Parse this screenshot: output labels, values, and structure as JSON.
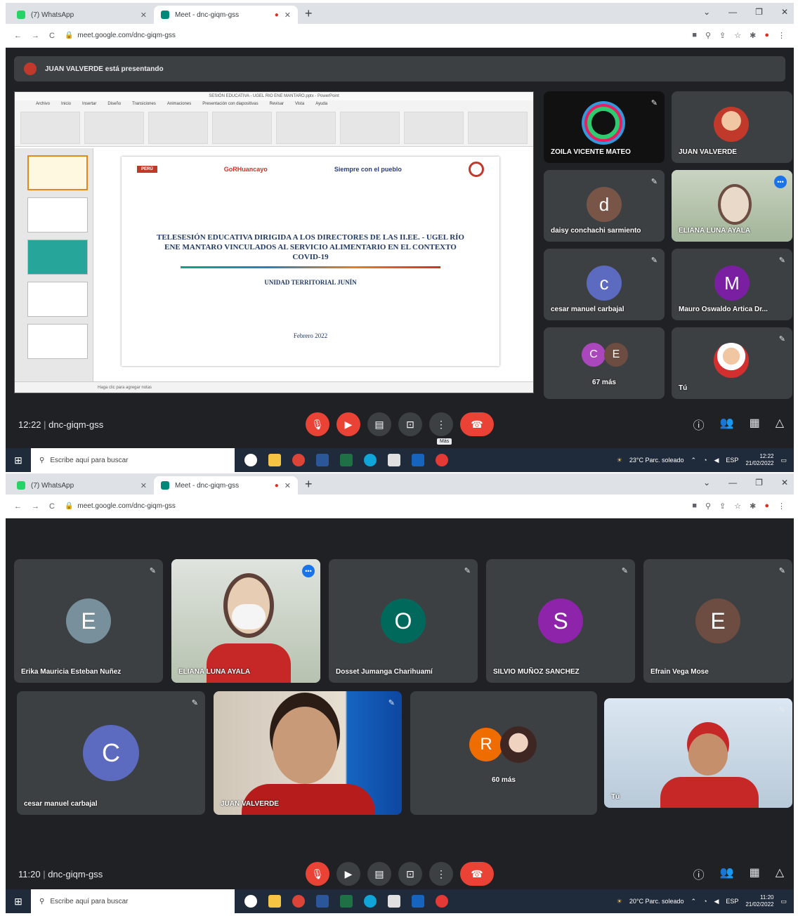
{
  "s1": {
    "tabs": [
      {
        "label": "(7) WhatsApp",
        "color": "#25d366",
        "active": false
      },
      {
        "label": "Meet - dnc-giqm-gss",
        "color": "#00897b",
        "active": true
      }
    ],
    "url": "meet.google.com/dnc-giqm-gss",
    "presenting": "JUAN VALVERDE está presentando",
    "slide": {
      "window_title": "SESIÓN EDUCATIVA - UGEL RIO ENE MANTARO.pptx - PowerPoint",
      "ribbon_tabs": [
        "Archivo",
        "Inicio",
        "Insertar",
        "Diseño",
        "Transiciones",
        "Animaciones",
        "Presentación con diapositivas",
        "Revisar",
        "Vista",
        "Ayuda"
      ],
      "logo_peru": "PERÚ",
      "logo_gore": "GoRHuancayo",
      "logo_siempre": "Siempre con el pueblo",
      "title": "TELESESIÓN EDUCATIVA DIRIGIDA A LOS DIRECTORES DE LAS II.EE. - UGEL RÍO ENE MANTARO VINCULADOS AL SERVICIO ALIMENTARIO EN EL CONTEXTO COVID-19",
      "subtitle": "UNIDAD TERRITORIAL JUNÍN",
      "date": "Febrero 2022",
      "notes": "Haga clic para agregar notas"
    },
    "tiles": [
      {
        "name": "ZOILA VICENTE MATEO"
      },
      {
        "name": "JUAN VALVERDE"
      },
      {
        "name": "daisy conchachi sarmiento",
        "initial": "d",
        "color": "#795548"
      },
      {
        "name": "ELIANA LUNA AYALA"
      },
      {
        "name": "cesar manuel carbajal",
        "initial": "c",
        "color": "#5c6bc0"
      },
      {
        "name": "Mauro Oswaldo Artica Dr...",
        "initial": "M",
        "color": "#7b1fa2"
      },
      {
        "name": "67 más",
        "initial_a": "C",
        "initial_b": "E"
      },
      {
        "name": "Tú"
      }
    ],
    "meeting_time": "12:22",
    "meeting_code": "dnc-giqm-gss",
    "tooltip": "Más",
    "search_placeholder": "Escribe aquí para buscar",
    "weather": "23°C Parc. soleado",
    "lang": "ESP",
    "clock_time": "12:22",
    "clock_date": "21/02/2022"
  },
  "s2": {
    "tabs": [
      {
        "label": "(7) WhatsApp",
        "color": "#25d366",
        "active": false
      },
      {
        "label": "Meet - dnc-giqm-gss",
        "color": "#00897b",
        "active": true
      }
    ],
    "url": "meet.google.com/dnc-giqm-gss",
    "tiles_row1": [
      {
        "name": "Erika Mauricia Esteban Nuñez",
        "initial": "E",
        "color": "#78909c"
      },
      {
        "name": "ELIANA LUNA AYALA"
      },
      {
        "name": "Dosset Jumanga Charihuamí",
        "initial": "O",
        "color": "#00695c"
      },
      {
        "name": "SILVIO MUÑOZ SANCHEZ",
        "initial": "S",
        "color": "#8e24aa"
      },
      {
        "name": "Efrain Vega Mose",
        "initial": "E",
        "color": "#6d4c41"
      }
    ],
    "tiles_row2": [
      {
        "name": "cesar manuel carbajal",
        "initial": "C",
        "color": "#5c6bc0"
      },
      {
        "name": "JUAN VALVERDE"
      },
      {
        "name": "60 más",
        "initial": "R",
        "color": "#ef6c00"
      },
      {
        "name": "Tú"
      }
    ],
    "meeting_time": "11:20",
    "meeting_code": "dnc-giqm-gss",
    "search_placeholder": "Escribe aquí para buscar",
    "weather": "20°C Parc. soleado",
    "lang": "ESP",
    "clock_time": "11:20",
    "clock_date": "21/02/2022"
  },
  "colors": {
    "meet_bg": "#202124",
    "tile_bg": "#3c4043",
    "end_call": "#ea4335",
    "active_speaker": "#8ab4f8"
  }
}
